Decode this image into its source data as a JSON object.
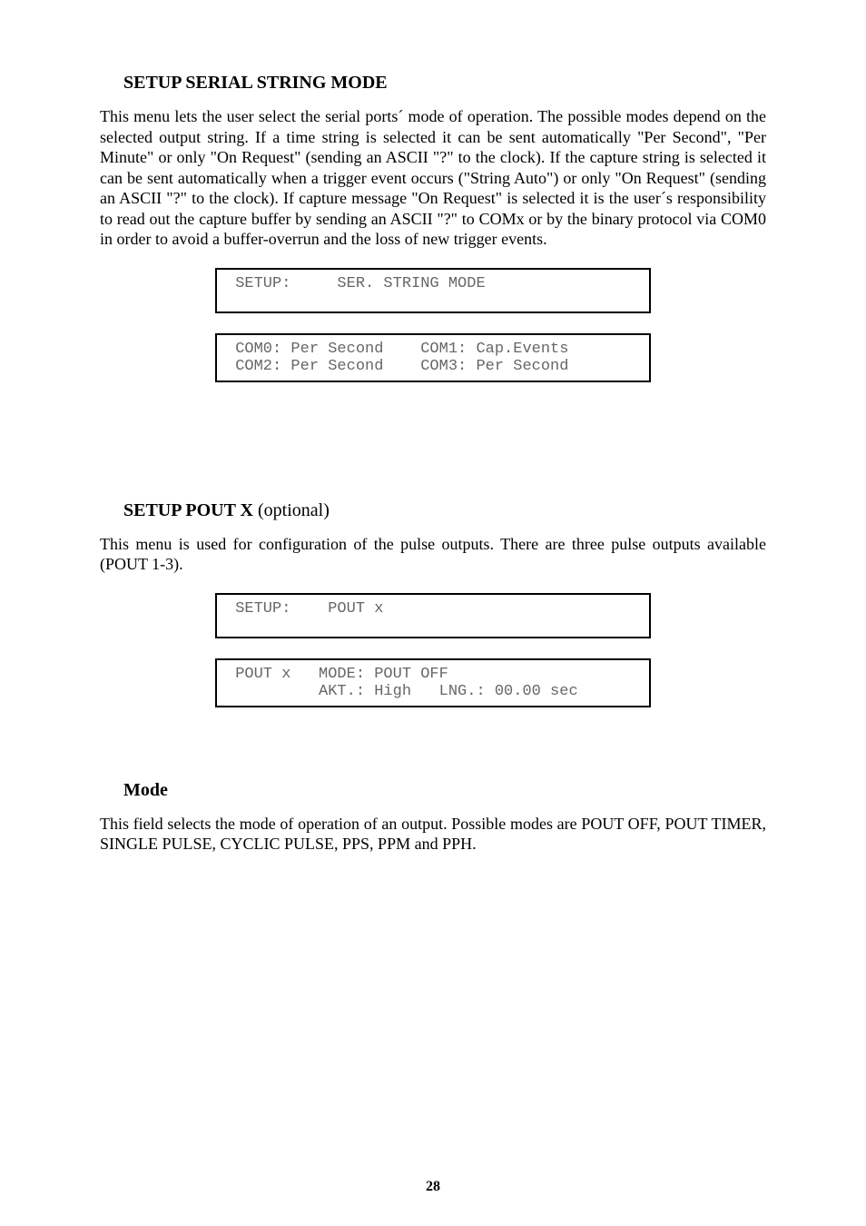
{
  "section1": {
    "heading": "SETUP SERIAL STRING MODE",
    "para": "This menu lets the user select the serial ports´ mode of operation. The possible modes depend on the selected output string. If a time string is selected it can be sent automatically \"Per Second\", \"Per Minute\" or only \"On Request\" (sending an ASCII \"?\" to the clock). If the capture string is selected it can be sent automatically when a trigger event occurs (\"String Auto\") or only \"On Request\" (sending an ASCII \"?\" to the clock). If capture message \"On Request\" is selected it is the user´s responsibility to read out the capture buffer by sending an ASCII \"?\" to COMx or by the binary protocol via COM0 in order to avoid a buffer-overrun and the loss of new trigger events.",
    "box1": " SETUP:     SER. STRING MODE",
    "box2": " COM0: Per Second    COM1: Cap.Events\n COM2: Per Second    COM3: Per Second"
  },
  "section2": {
    "heading_bold": "SETUP POUT X",
    "heading_tail": " (optional)",
    "para": "This menu is used for configuration of the pulse outputs. There are three pulse outputs available (POUT 1-3).",
    "box1": " SETUP:    POUT x",
    "box2": " POUT x   MODE: POUT OFF\n          AKT.: High   LNG.: 00.00 sec"
  },
  "section3": {
    "heading": "Mode",
    "para": "This field selects the mode of operation of an output. Possible modes are POUT OFF, POUT TIMER, SINGLE PULSE, CYCLIC PULSE, PPS, PPM and PPH."
  },
  "pagenum": "28"
}
